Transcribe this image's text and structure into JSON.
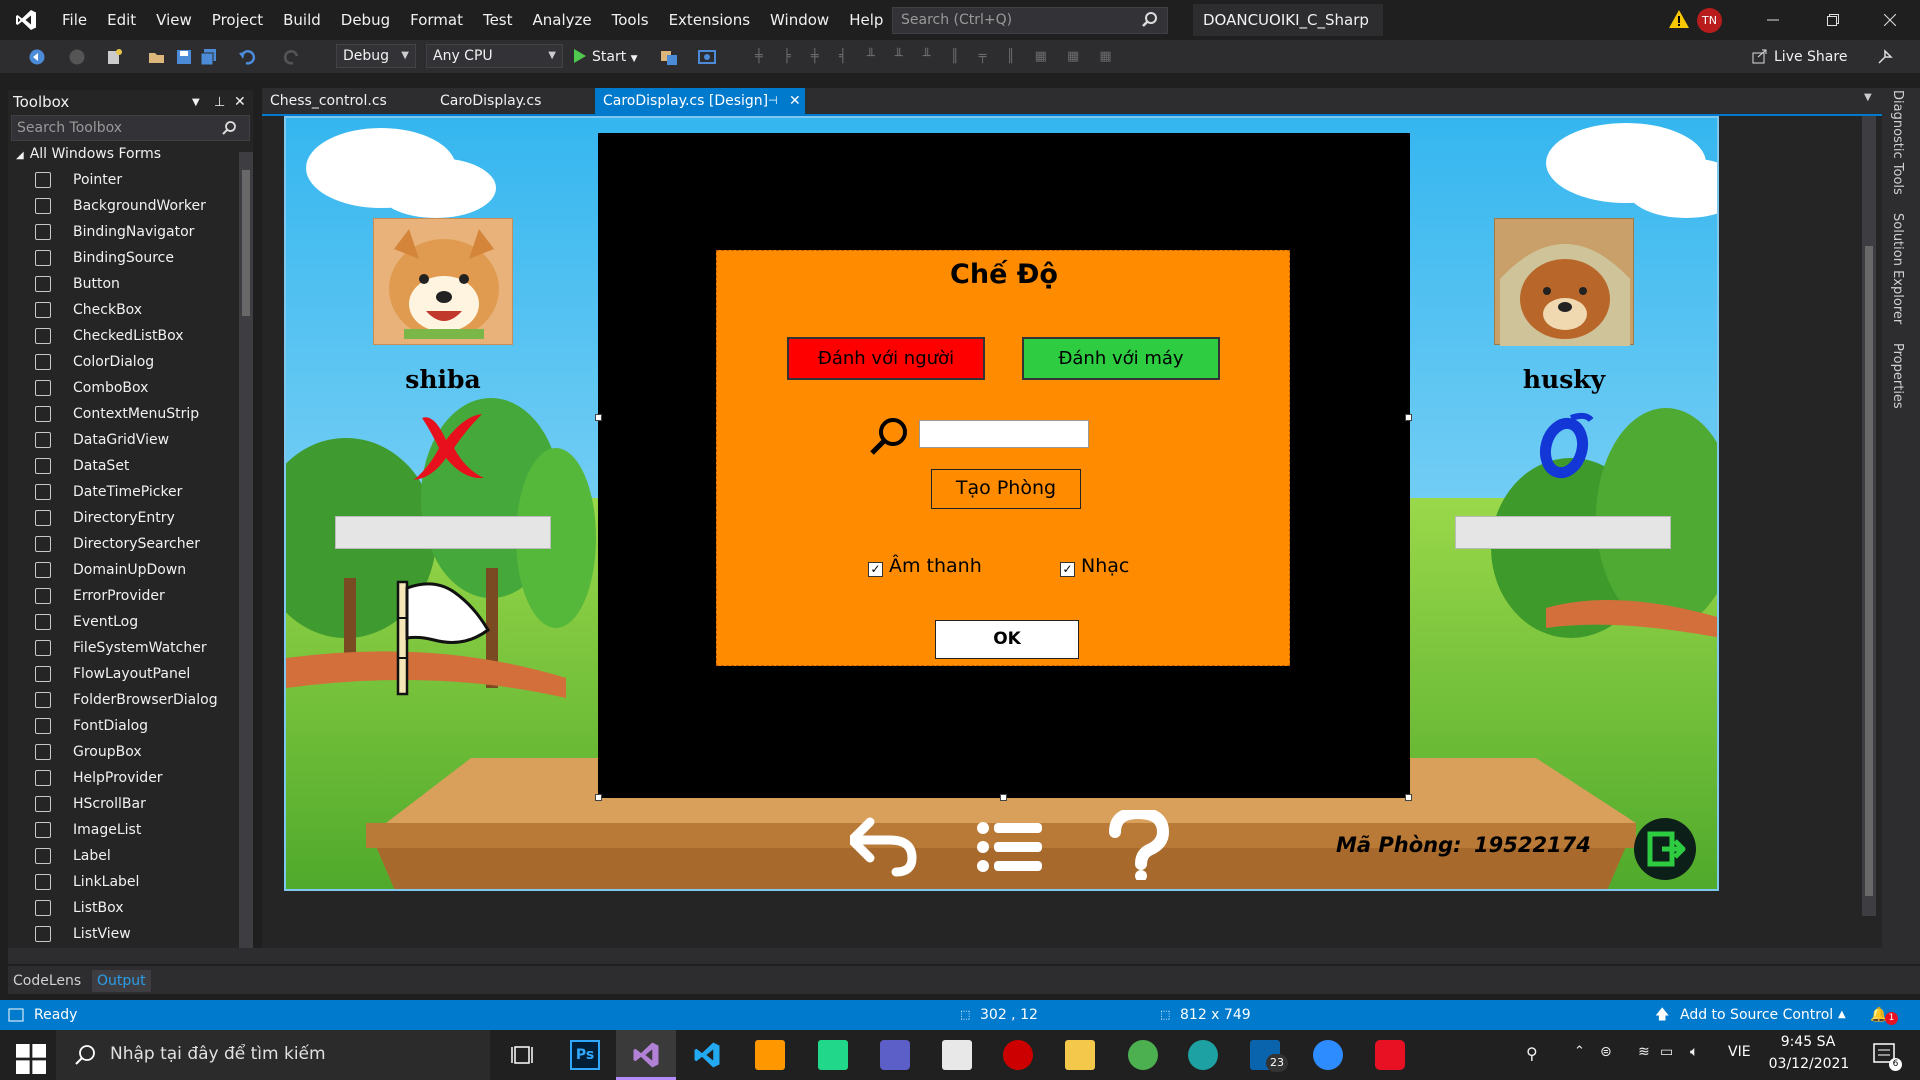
{
  "menu": [
    "File",
    "Edit",
    "View",
    "Project",
    "Build",
    "Debug",
    "Format",
    "Test",
    "Analyze",
    "Tools",
    "Extensions",
    "Window",
    "Help"
  ],
  "search_placeholder": "Search (Ctrl+Q)",
  "project_title": "DOANCUOIKI_C_Sharp",
  "user_initials": "TN",
  "toolbar": {
    "config": "Debug",
    "platform": "Any CPU",
    "start": "Start",
    "live_share": "Live Share"
  },
  "toolbox": {
    "title": "Toolbox",
    "search_placeholder": "Search Toolbox",
    "group": "All Windows Forms",
    "items": [
      "Pointer",
      "BackgroundWorker",
      "BindingNavigator",
      "BindingSource",
      "Button",
      "CheckBox",
      "CheckedListBox",
      "ColorDialog",
      "ComboBox",
      "ContextMenuStrip",
      "DataGridView",
      "DataSet",
      "DateTimePicker",
      "DirectoryEntry",
      "DirectorySearcher",
      "DomainUpDown",
      "ErrorProvider",
      "EventLog",
      "FileSystemWatcher",
      "FlowLayoutPanel",
      "FolderBrowserDialog",
      "FontDialog",
      "GroupBox",
      "HelpProvider",
      "HScrollBar",
      "ImageList",
      "Label",
      "LinkLabel",
      "ListBox",
      "ListView"
    ]
  },
  "tabs": [
    "Chess_control.cs",
    "CaroDisplay.cs",
    "CaroDisplay.cs [Design]"
  ],
  "side_panels": [
    "Diagnostic Tools",
    "Solution Explorer",
    "Properties"
  ],
  "game": {
    "player1_name": "shiba",
    "player1_mark": "X",
    "player2_name": "husky",
    "player2_mark": "O",
    "room_label": "Mã Phòng:",
    "room_code": "19522174"
  },
  "dialog": {
    "title": "Chế Độ",
    "btn_pvp": "Đánh với người",
    "btn_pvc": "Đánh với máy",
    "btn_create_room": "Tạo Phòng",
    "chk_sound": "Âm thanh",
    "chk_music": "Nhạc",
    "btn_ok": "OK"
  },
  "bottom_tabs": [
    "CodeLens",
    "Output"
  ],
  "status": {
    "ready": "Ready",
    "cursor": "302 , 12",
    "size": "812 x 749",
    "source_control": "Add to Source Control",
    "notif_count": "1"
  },
  "taskbar": {
    "search_placeholder": "Nhập tại đây để tìm kiếm",
    "lang": "VIE",
    "time": "9:45 SA",
    "date": "03/12/2021",
    "mail_count": "23",
    "notif": "6"
  },
  "colors": {
    "accent": "#007acc",
    "dialog_bg": "#ff8c00",
    "pvp": "#ff0000",
    "pvc": "#2ecc40"
  }
}
